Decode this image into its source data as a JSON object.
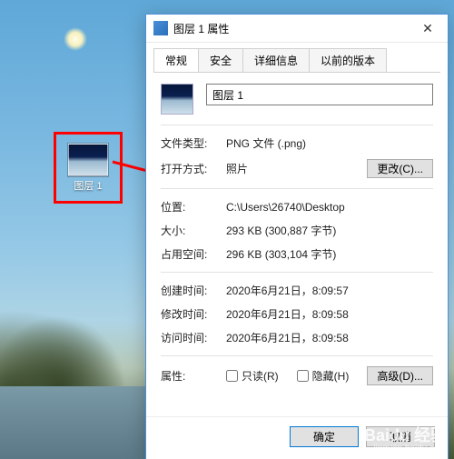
{
  "desktop": {
    "icon_label": "图层 1"
  },
  "dialog": {
    "title": "图层 1 属性",
    "tabs": [
      "常规",
      "安全",
      "详细信息",
      "以前的版本"
    ],
    "active_tab": 0,
    "filename": "图层 1",
    "rows": {
      "type_label": "文件类型:",
      "type_value": "PNG 文件 (.png)",
      "open_with_label": "打开方式:",
      "open_with_value": "照片",
      "change_btn": "更改(C)...",
      "location_label": "位置:",
      "location_value": "C:\\Users\\26740\\Desktop",
      "size_label": "大小:",
      "size_value": "293 KB (300,887 字节)",
      "sizeondisk_label": "占用空间:",
      "sizeondisk_value": "296 KB (303,104 字节)",
      "created_label": "创建时间:",
      "created_value": "2020年6月21日，8:09:57",
      "modified_label": "修改时间:",
      "modified_value": "2020年6月21日，8:09:58",
      "accessed_label": "访问时间:",
      "accessed_value": "2020年6月21日，8:09:58",
      "attr_label": "属性:",
      "readonly": "只读(R)",
      "hidden": "隐藏(H)",
      "advanced_btn": "高级(D)..."
    },
    "footer": {
      "ok": "确定",
      "cancel": "取消"
    }
  },
  "watermark": {
    "main": "Baidu 经验",
    "sub": "jingyan.baidu.com"
  }
}
